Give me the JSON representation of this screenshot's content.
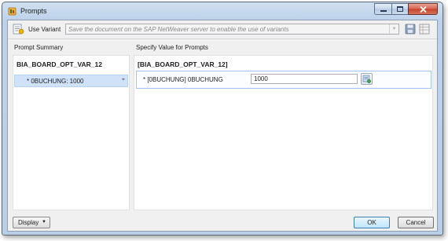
{
  "window": {
    "title": "Prompts",
    "colors": {
      "frame": "#bcd2ea",
      "selection": "#cfe2f8",
      "close": "#c4412a"
    }
  },
  "toolbar": {
    "use_variant_label": "Use Variant",
    "variant_placeholder": "Save the document on the SAP NetWeaver server to enable the use of variants",
    "icons": [
      "variant-icon",
      "save-icon",
      "table-icon"
    ]
  },
  "headers": {
    "prompt_summary": "Prompt Summary",
    "specify_value": "Specify Value for Prompts"
  },
  "summary": {
    "title": "BIA_BOARD_OPT_VAR_12",
    "items": [
      {
        "label": "* 0BUCHUNG: 1000"
      }
    ]
  },
  "prompts": {
    "title": "[BIA_BOARD_OPT_VAR_12]",
    "rows": [
      {
        "label": "* [0BUCHUNG] 0BUCHUNG",
        "value": "1000"
      }
    ]
  },
  "footer": {
    "display_label": "Display",
    "ok_label": "OK",
    "cancel_label": "Cancel"
  }
}
